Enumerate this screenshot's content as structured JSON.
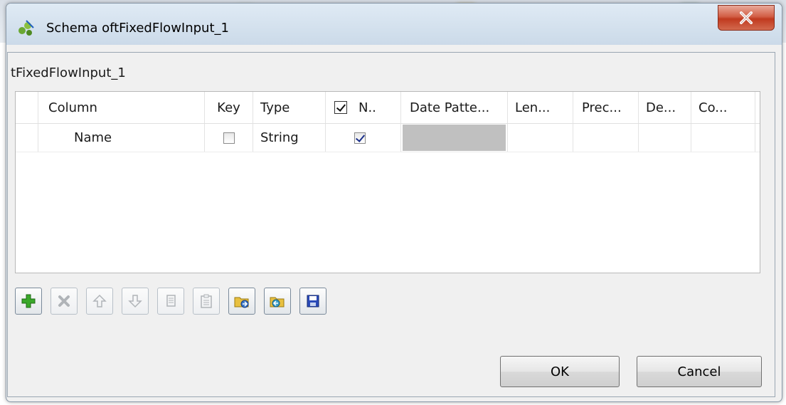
{
  "window": {
    "title": "Schema oftFixedFlowInput_1",
    "close_glyph": "X"
  },
  "group": {
    "label": "tFixedFlowInput_1"
  },
  "table": {
    "columns": {
      "column": "Column",
      "key": "Key",
      "type": "Type",
      "nullable": "N..",
      "date_pattern": "Date Patte...",
      "length": "Len...",
      "precision": "Prec...",
      "default": "De...",
      "comment": "Co..."
    },
    "rows": [
      {
        "column": "Name",
        "key": false,
        "type": "String",
        "nullable": true,
        "date_pattern": "",
        "length": "",
        "precision": "",
        "default": "",
        "comment": ""
      }
    ]
  },
  "toolbar": {
    "icons": [
      "add-icon",
      "remove-icon",
      "move-up-icon",
      "move-down-icon",
      "copy-icon",
      "paste-icon",
      "import-icon",
      "export-icon",
      "save-icon"
    ]
  },
  "buttons": {
    "ok": "OK",
    "cancel": "Cancel"
  },
  "colors": {
    "close": "#c8442a",
    "add": "#2a9a1a",
    "save": "#2040b0",
    "folder": "#e8c040"
  }
}
